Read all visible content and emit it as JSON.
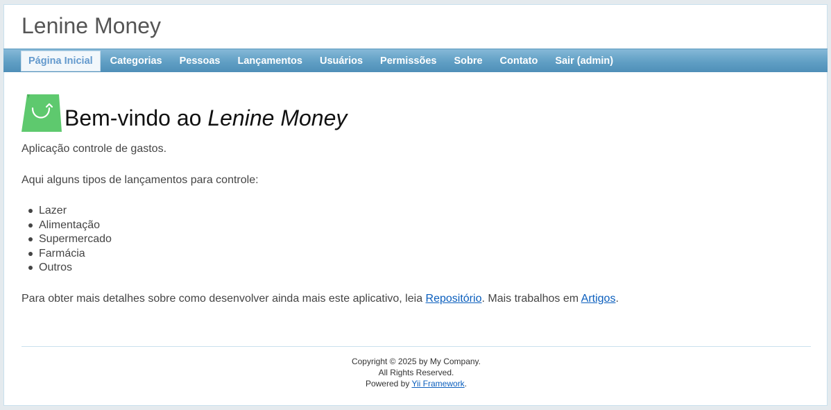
{
  "app": {
    "title": "Lenine Money"
  },
  "nav": {
    "items": [
      {
        "label": "Página Inicial",
        "active": true
      },
      {
        "label": "Categorias",
        "active": false
      },
      {
        "label": "Pessoas",
        "active": false
      },
      {
        "label": "Lançamentos",
        "active": false
      },
      {
        "label": "Usuários",
        "active": false
      },
      {
        "label": "Permissões",
        "active": false
      },
      {
        "label": "Sobre",
        "active": false
      },
      {
        "label": "Contato",
        "active": false
      },
      {
        "label": "Sair (admin)",
        "active": false
      }
    ]
  },
  "main": {
    "icon": "shopping-bag-icon",
    "heading_prefix": "Bem-vindo ao ",
    "heading_app": "Lenine Money",
    "intro": "Aplicação controle de gastos.",
    "types_intro": "Aqui alguns tipos de lançamentos para controle:",
    "types": [
      "Lazer",
      "Alimentação",
      "Supermercado",
      "Farmácia",
      "Outros"
    ],
    "details_prefix": "Para obter mais detalhes sobre como desenvolver ainda mais este aplicativo, leia ",
    "details_link1": "Repositório",
    "details_middle": ". Mais trabalhos em ",
    "details_link2": "Artigos",
    "details_suffix": "."
  },
  "footer": {
    "copyright": "Copyright © 2025 by My Company.",
    "rights": "All Rights Reserved.",
    "powered_prefix": "Powered by ",
    "powered_link": "Yii Framework",
    "powered_suffix": "."
  },
  "colors": {
    "nav_bar": "#5e9dc3",
    "active_tab_bg": "#f2f7fb",
    "active_tab_text": "#6399cd",
    "link": "#0a5ebd",
    "bag_icon": "#5ec96e"
  }
}
